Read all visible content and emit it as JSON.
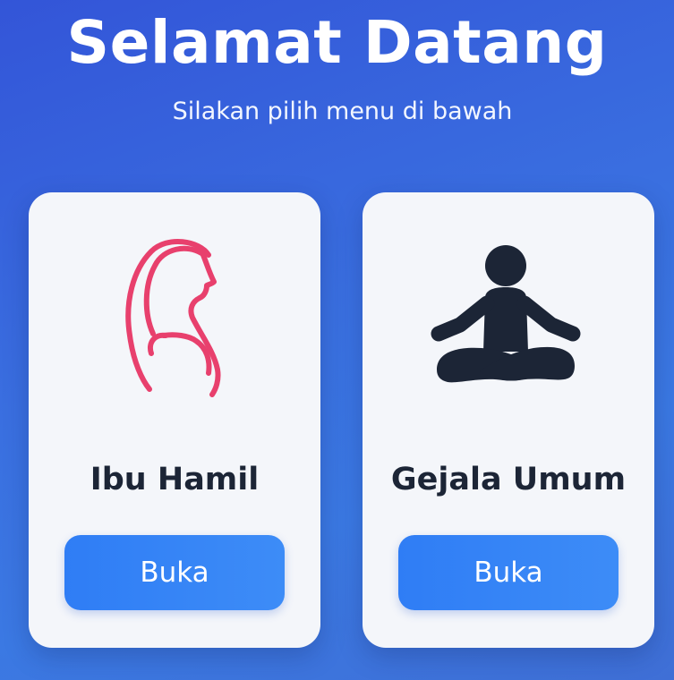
{
  "header": {
    "title": "Selamat Datang",
    "subtitle": "Silakan pilih menu di bawah"
  },
  "cards": [
    {
      "label": "Ibu Hamil",
      "icon": "pregnant-woman-icon",
      "icon_color": "#e8406d",
      "button_label": "Buka"
    },
    {
      "label": "Gejala Umum",
      "icon": "meditating-person-icon",
      "icon_color": "#1c2536",
      "button_label": "Buka"
    }
  ],
  "colors": {
    "background": "#3a6fe0",
    "button": "#2f7df5",
    "card": "#f4f6fa",
    "text_dark": "#1c2536"
  }
}
